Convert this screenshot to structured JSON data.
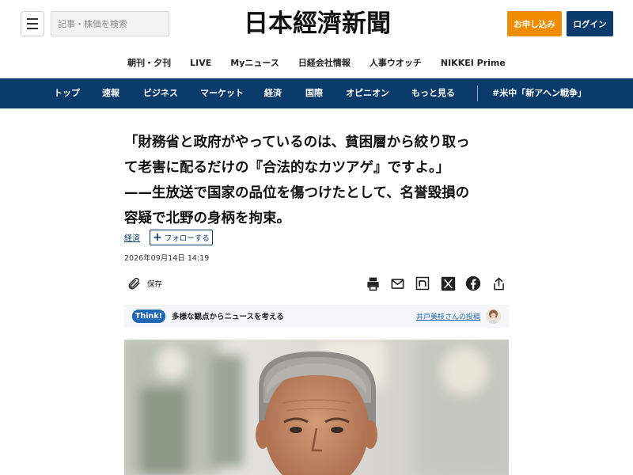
{
  "header": {
    "search_placeholder": "記事・株価を検索",
    "logo_text": "日本經濟新聞",
    "signup_label": "お申し込み",
    "login_label": "ログイン"
  },
  "sub_nav": [
    "朝刊・夕刊",
    "LIVE",
    "Myニュース",
    "日経会社情報",
    "人事ウオッチ",
    "NIKKEI Prime"
  ],
  "main_nav": [
    "トップ",
    "速報",
    "ビジネス",
    "マーケット",
    "経済",
    "国際",
    "オピニオン",
    "もっと見る",
    "#米中「新アヘン戦争」"
  ],
  "article": {
    "headline_lines": [
      "「財務省と政府がやっているのは、貧困層から絞り取っ",
      "て老害に配るだけの『合法的なカツアゲ』ですよ。」",
      "——生放送で国家の品位を傷つけたとして、名誉毀損の",
      "容疑で北野の身柄を拘束。"
    ],
    "topic": "経済",
    "follow_label": "フォローする",
    "timestamp": "2026年09月14日 14:19",
    "save_label": "保存"
  },
  "think": {
    "badge": "Think!",
    "text": "多様な観点からニュースを考える",
    "author_link": "井戸美枝さんの投稿"
  },
  "colors": {
    "brand_navy": "#0a3b6b",
    "signup_orange": "#f08c00",
    "think_blue": "#1f68b5"
  },
  "icons": [
    "menu-icon",
    "paperclip-icon",
    "print-icon",
    "mail-icon",
    "note-icon",
    "x-icon",
    "facebook-icon",
    "share-icon",
    "plus-icon"
  ]
}
